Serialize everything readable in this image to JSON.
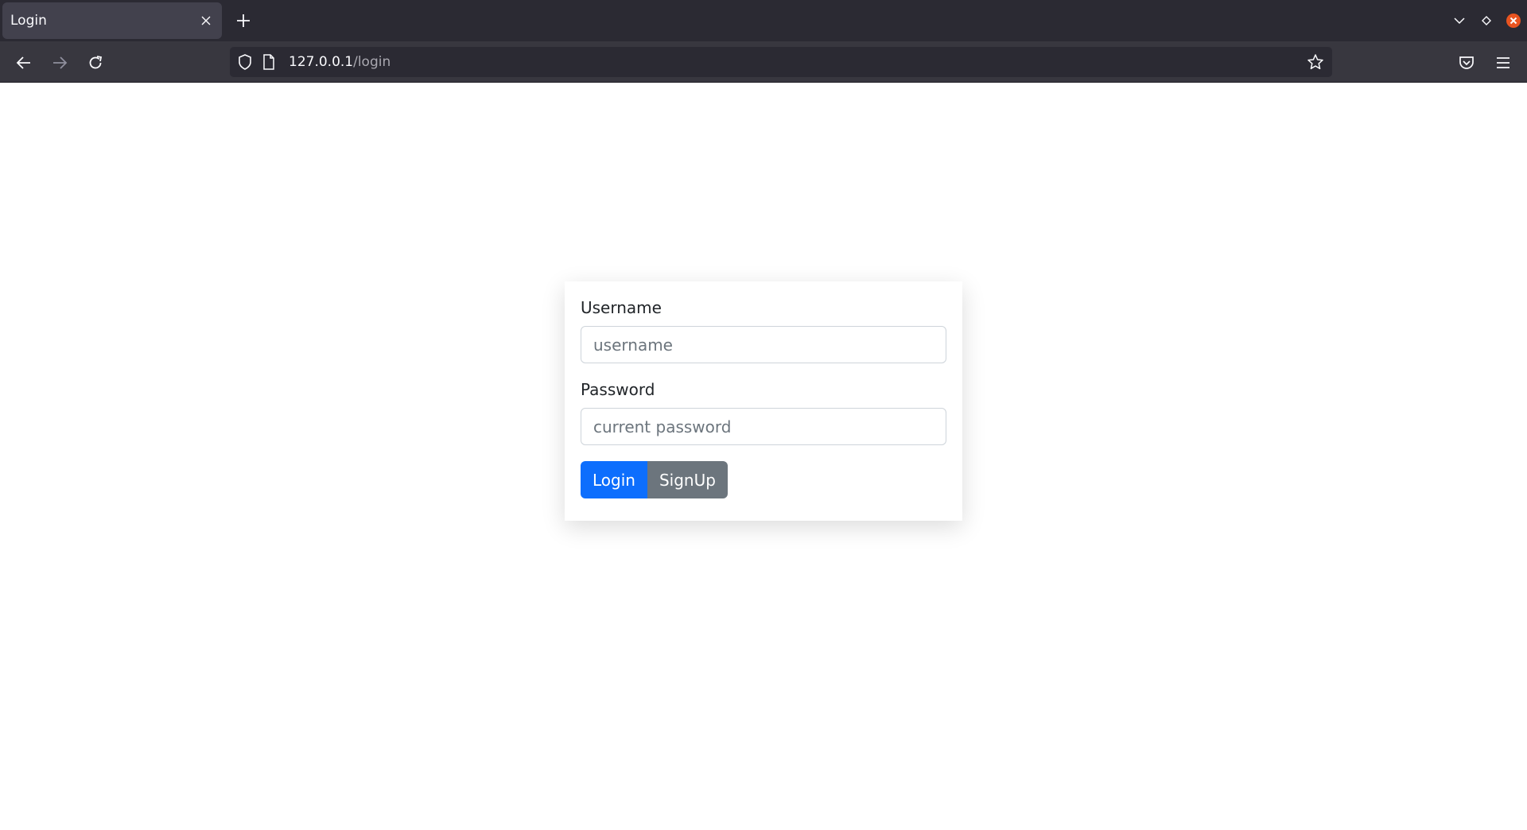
{
  "browser": {
    "tab_title": "Login",
    "url_host": "127.0.0.1",
    "url_path": "/login",
    "icons": {
      "tab_close": "close-icon",
      "new_tab": "plus-icon",
      "tab_list": "chevron-down-icon",
      "extension": "diamond-icon",
      "profile": "firefox-close-badge-icon",
      "back": "back-arrow-icon",
      "forward": "forward-arrow-icon",
      "reload": "reload-icon",
      "shield": "shield-icon",
      "page": "page-icon",
      "bookmark": "star-icon",
      "pocket": "pocket-icon",
      "menu": "hamburger-menu-icon"
    },
    "colors": {
      "tabbar": "#2b2a33",
      "navbar": "#38373f",
      "active_tab": "#42414d"
    }
  },
  "login_form": {
    "username_label": "Username",
    "username_placeholder": "username",
    "username_value": "",
    "password_label": "Password",
    "password_placeholder": "current password",
    "password_value": "",
    "login_button": "Login",
    "signup_button": "SignUp",
    "colors": {
      "primary": "#0d6efd",
      "secondary": "#6c757d"
    }
  }
}
